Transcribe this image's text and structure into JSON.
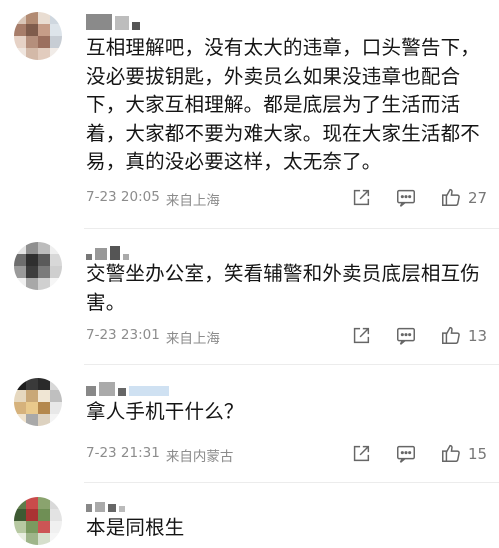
{
  "comments": [
    {
      "text": "互相理解吧，没有太大的违章，口头警告下，没必要拔钥匙，外卖员么如果没违章也配合下，大家互相理解。都是底层为了生活而活着，大家都不要为难大家。现在大家生活都不易，真的没必要这样，太无奈了。",
      "date": "7-23 20:05",
      "location": "来自上海",
      "likes": "27"
    },
    {
      "text": "交警坐办公室，笑看辅警和外卖员底层相互伤害。",
      "date": "7-23 23:01",
      "location": "来自上海",
      "likes": "13"
    },
    {
      "text": "拿人手机干什么？",
      "date": "7-23 21:31",
      "location": "来自内蒙古",
      "likes": "15"
    },
    {
      "text": "本是同根生",
      "date": "",
      "location": "",
      "likes": ""
    }
  ],
  "icons": {
    "share": "share-icon",
    "comment": "comment-icon",
    "like": "thumbs-up-icon"
  },
  "colors": {
    "text": "#141414",
    "meta": "#8c8c8c",
    "icon": "#666666"
  }
}
